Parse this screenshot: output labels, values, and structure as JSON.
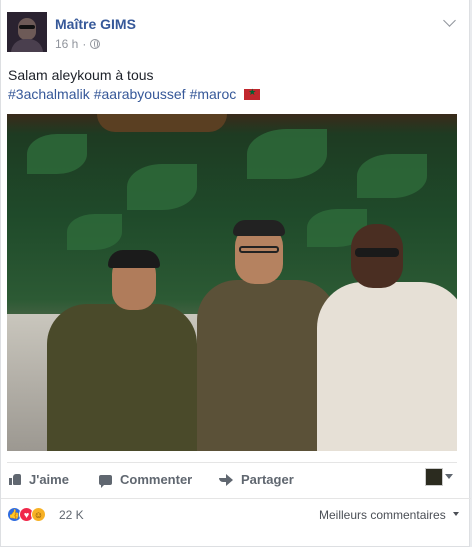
{
  "post": {
    "author": "Maître GIMS",
    "time": "16 h",
    "text": "Salam aleykoum à tous",
    "hashtags": [
      "#3achalmalik",
      "#aarabyoussef",
      "#maroc"
    ],
    "icons": {
      "privacy": "globe-icon",
      "options": "chevron-down-icon",
      "flag": "morocco-flag-icon"
    }
  },
  "actions": {
    "like": "J'aime",
    "comment": "Commenter",
    "share": "Partager"
  },
  "reactions": {
    "count": "22 K",
    "sort": "Meilleurs commentaires",
    "types": [
      "like",
      "love",
      "haha"
    ]
  },
  "colors": {
    "link": "#365899",
    "muted": "#90949c",
    "background": "#e9ebee"
  }
}
